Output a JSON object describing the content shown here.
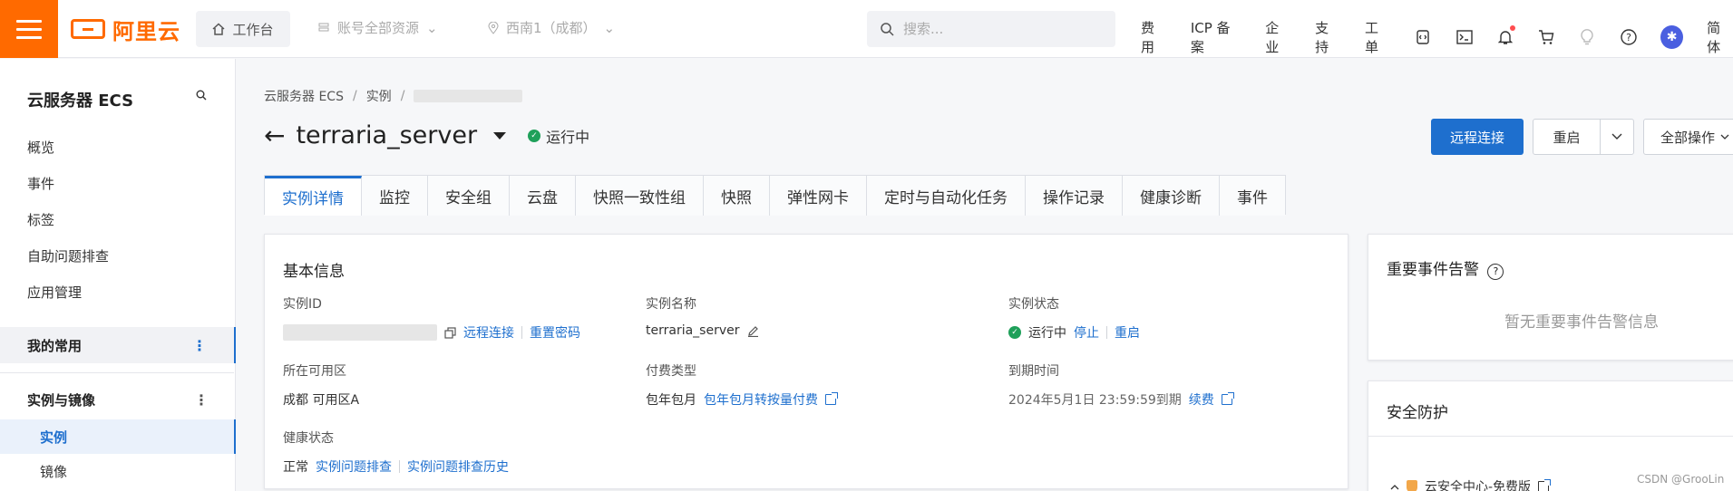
{
  "brand": {
    "name": "阿里云",
    "accent": "#ff6a00"
  },
  "topbar": {
    "worktab": "工作台",
    "resource_selector": "账号全部资源",
    "region_selector": "西南1（成都）",
    "search_placeholder": "搜索...",
    "nav": [
      "费用",
      "ICP 备案",
      "企业",
      "支持",
      "工单"
    ],
    "language": "简体"
  },
  "sidebar": {
    "title": "云服务器 ECS",
    "items": [
      "概览",
      "事件",
      "标签",
      "自助问题排查",
      "应用管理"
    ],
    "favorites": "我的常用",
    "group": "实例与镜像",
    "sub_items": [
      "实例",
      "镜像"
    ]
  },
  "breadcrumb": {
    "root": "云服务器 ECS",
    "level2": "实例",
    "sep": "/"
  },
  "instance": {
    "back": "←",
    "name": "terraria_server",
    "status": "运行中"
  },
  "actions": {
    "connect": "远程连接",
    "restart": "重启",
    "all_ops": "全部操作"
  },
  "tabs": [
    "实例详情",
    "监控",
    "安全组",
    "云盘",
    "快照一致性组",
    "快照",
    "弹性网卡",
    "定时与自动化任务",
    "操作记录",
    "健康诊断",
    "事件"
  ],
  "basic": {
    "title": "基本信息",
    "id_label": "实例ID",
    "id_links": [
      "远程连接",
      "重置密码"
    ],
    "name_label": "实例名称",
    "name_value": "terraria_server",
    "status_label": "实例状态",
    "status_value": "运行中",
    "status_links": [
      "停止",
      "重启"
    ],
    "zone_label": "所在可用区",
    "zone_value": "成都 可用区A",
    "billing_label": "付费类型",
    "billing_value": "包年包月",
    "billing_link": "包年包月转按量付费",
    "expire_label": "到期时间",
    "expire_value": "2024年5月1日 23:59:59到期",
    "expire_link": "续费",
    "health_label": "健康状态",
    "health_value": "正常",
    "health_links": [
      "实例问题排查",
      "实例问题排查历史"
    ]
  },
  "alerts": {
    "title": "重要事件告警",
    "empty": "暂无重要事件告警信息"
  },
  "security": {
    "title": "安全防护",
    "item": "云安全中心-免费版"
  },
  "watermark": "CSDN @GrooLin"
}
